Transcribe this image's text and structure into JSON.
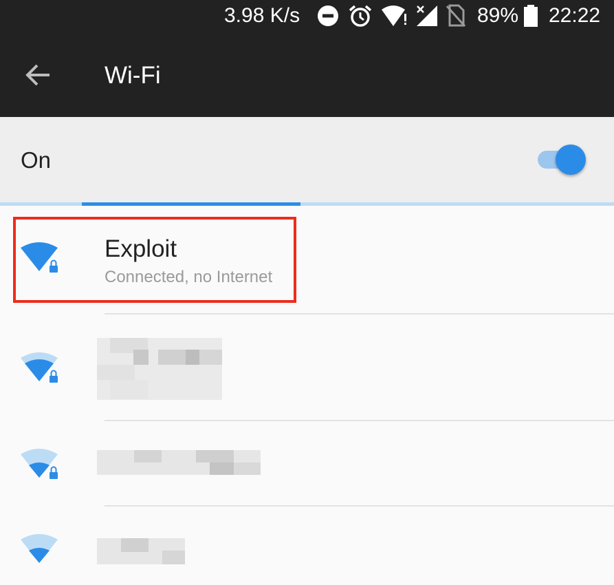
{
  "status_bar": {
    "net_speed": "3.98 K/s",
    "battery": "89%",
    "time": "22:22",
    "icons": [
      "do-not-disturb-icon",
      "alarm-icon",
      "wifi-icon",
      "cellular-signal-icon",
      "no-sim-icon",
      "battery-icon"
    ]
  },
  "app_bar": {
    "title": "Wi-Fi",
    "back_icon": "arrow-back-icon"
  },
  "wifi_toggle": {
    "label": "On",
    "enabled": true
  },
  "colors": {
    "accent": "#2b8ce8",
    "bar_bg": "#222222",
    "highlight": "#ee2c1a"
  },
  "networks": [
    {
      "name": "Exploit",
      "status": "Connected, no Internet",
      "secured": true,
      "signal": 4,
      "highlighted": true
    },
    {
      "name": "",
      "secured": true,
      "signal": 3
    },
    {
      "name": "",
      "secured": true,
      "signal": 2
    },
    {
      "name": "",
      "secured": false,
      "signal": 2
    }
  ]
}
